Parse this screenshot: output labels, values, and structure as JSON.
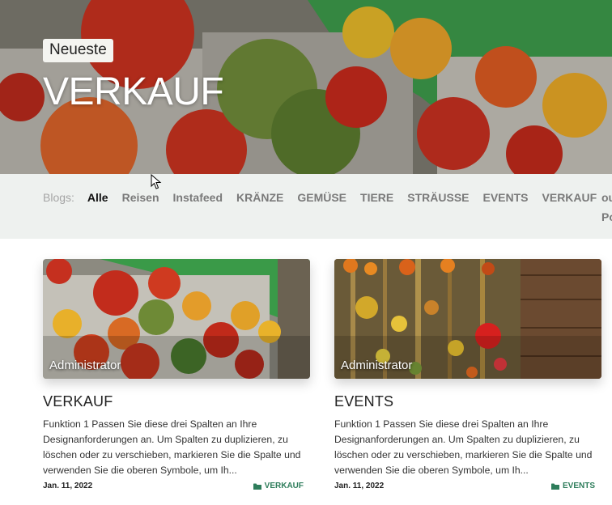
{
  "hero": {
    "badge": "Neueste",
    "title": "VERKAUF"
  },
  "filters": {
    "label": "Blogs:",
    "items": [
      "Alle",
      "Reisen",
      "Instafeed",
      "KRÄNZE",
      "GEMÜSE",
      "TIERE",
      "STRÄUSSE",
      "EVENTS",
      "VERKAUF"
    ],
    "active": "Alle",
    "overflow_1": "ou",
    "overflow_2": "Po"
  },
  "posts": [
    {
      "author": "Administrator",
      "title": "VERKAUF",
      "excerpt": "Funktion 1 Passen Sie diese drei Spalten an Ihre Designanforderungen an. Um Spalten zu duplizieren, zu löschen oder zu verschieben, markieren Sie die Spalte und verwenden Sie die oberen Symbole, um Ih...",
      "date": "Jan. 11, 2022",
      "tag": "VERKAUF",
      "tag_icon": "folder-icon"
    },
    {
      "author": "Administrator",
      "title": "EVENTS",
      "excerpt": "Funktion 1 Passen Sie diese drei Spalten an Ihre Designanforderungen an. Um Spalten zu duplizieren, zu löschen oder zu verschieben, markieren Sie die Spalte und verwenden Sie die oberen Symbole, um Ih...",
      "date": "Jan. 11, 2022",
      "tag": "EVENTS",
      "tag_icon": "folder-icon"
    }
  ],
  "colors": {
    "accent_green": "#2e7d5b",
    "filter_bg": "#eef1ef"
  }
}
